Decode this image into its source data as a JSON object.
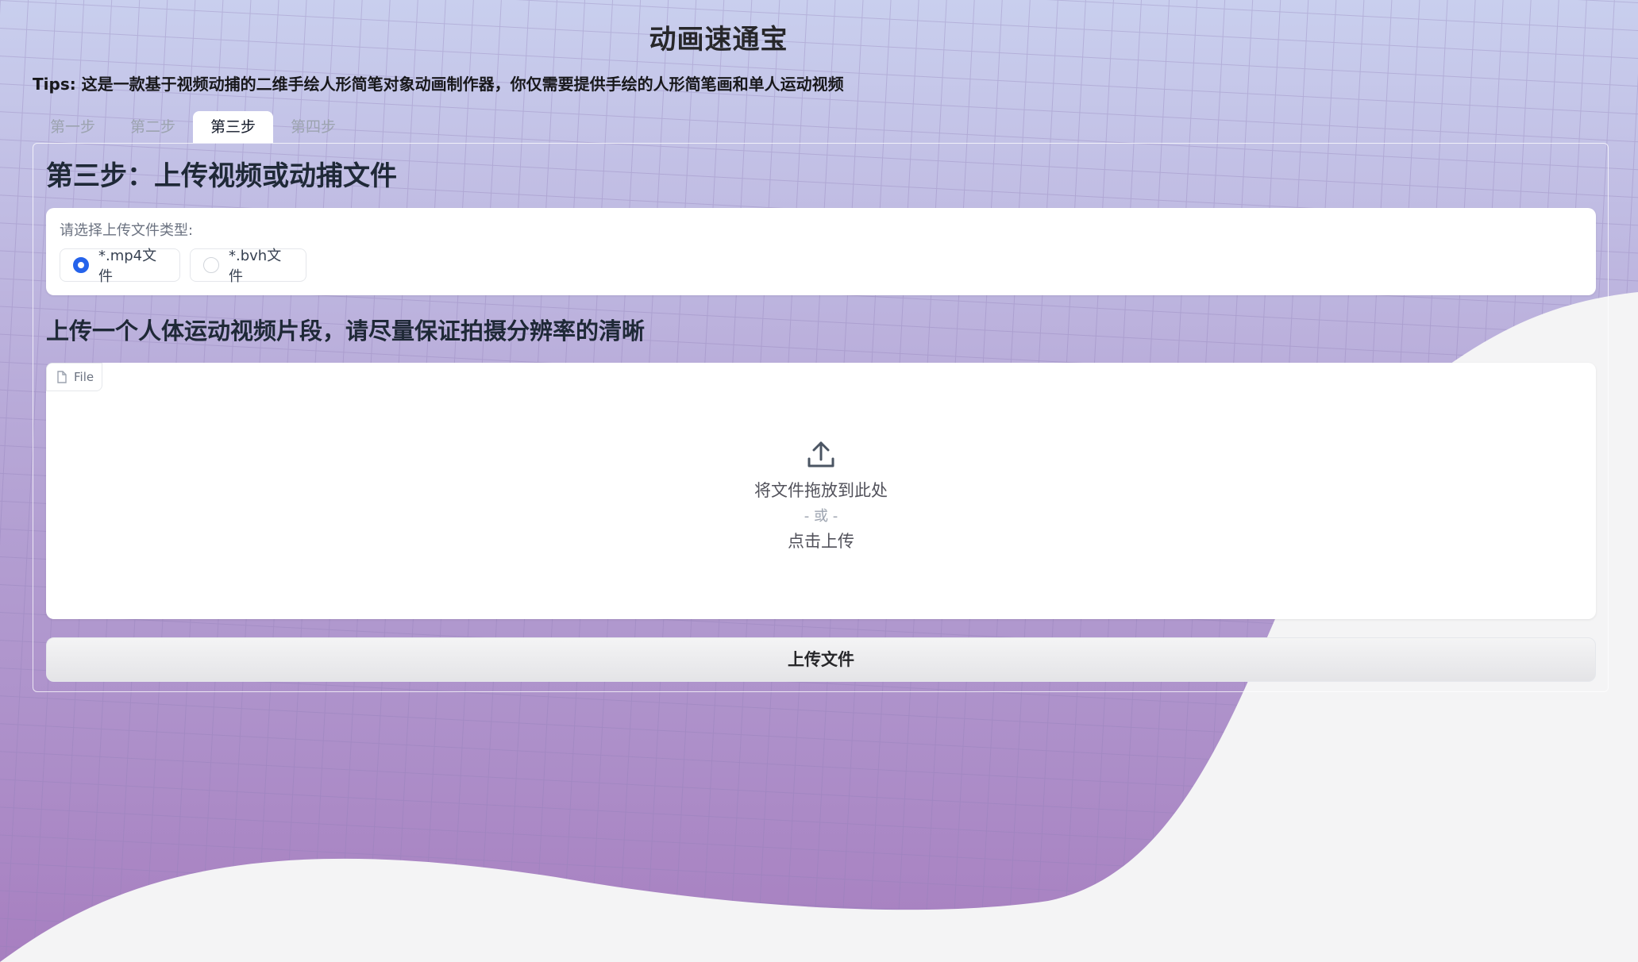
{
  "app": {
    "title": "动画速通宝",
    "tips": "Tips: 这是一款基于视频动捕的二维手绘人形简笔对象动画制作器，你仅需要提供手绘的人形简笔画和单人运动视频"
  },
  "tabs": [
    {
      "label": "第一步",
      "active": false
    },
    {
      "label": "第二步",
      "active": false
    },
    {
      "label": "第三步",
      "active": true
    },
    {
      "label": "第四步",
      "active": false
    }
  ],
  "step": {
    "heading": "第三步：上传视频或动捕文件"
  },
  "file_type": {
    "label": "请选择上传文件类型:",
    "options": [
      {
        "label": "*.mp4文件",
        "checked": true
      },
      {
        "label": "*.bvh文件",
        "checked": false
      }
    ]
  },
  "upload": {
    "heading": "上传一个人体运动视频片段，请尽量保证拍摄分辨率的清晰",
    "chip_label": "File",
    "drop_text": "将文件拖放到此处",
    "or_text": "- 或 -",
    "click_text": "点击上传",
    "icons": {
      "chip": "file-icon",
      "drop": "upload-icon"
    }
  },
  "actions": {
    "submit_label": "上传文件"
  },
  "colors": {
    "accent": "#2563eb",
    "bg_top": "#c9cfee",
    "bg_bottom": "#a885c2",
    "wave": "#f4f4f5"
  }
}
